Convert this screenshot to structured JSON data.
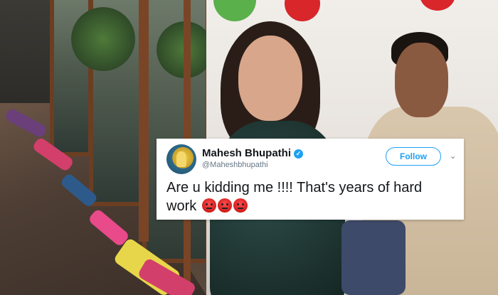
{
  "tweet": {
    "display_name": "Mahesh Bhupathi",
    "handle": "@Maheshbhupathi",
    "follow_label": "Follow",
    "chevron_icon": "chevron-down-icon",
    "verified_icon": "verified-badge-icon",
    "text": "Are u kidding me !!!! That's years of hard work",
    "emojis": [
      "angry-face-emoji",
      "angry-face-emoji",
      "angry-face-emoji"
    ]
  },
  "colors": {
    "twitter_blue": "#1da1f2",
    "text_dark": "#14171a",
    "handle_gray": "#657786"
  }
}
